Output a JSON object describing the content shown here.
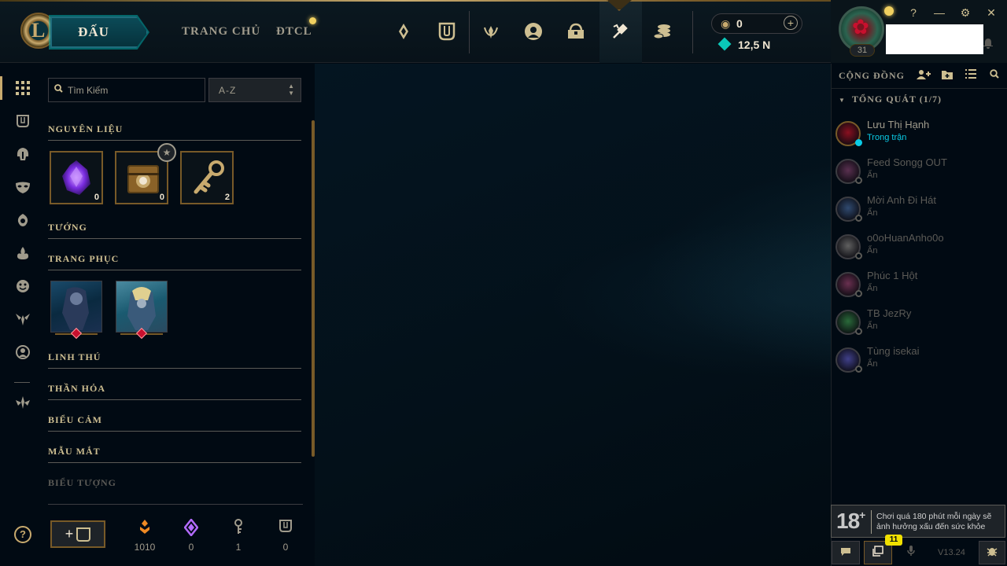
{
  "topbar": {
    "logo": "L",
    "play_label": "ĐẤU",
    "nav": [
      {
        "label": "TRANG CHỦ"
      },
      {
        "label": "ĐTCL"
      }
    ],
    "icons": [
      "ranked-icon",
      "collection-icon",
      "clash-icon",
      "profile-icon",
      "loot-icon",
      "crafting-icon",
      "store-icon"
    ],
    "rp_value": "0",
    "be_value": "12,5 N",
    "level": "31",
    "win_buttons": [
      "?",
      "—",
      "⚙",
      "✕"
    ]
  },
  "inventory": {
    "search_placeholder": "Tìm Kiếm",
    "sort_label": "A-Z",
    "categories": [
      "NGUYÊN LIỆU",
      "TƯỚNG",
      "TRANG PHỤC",
      "LINH THÚ",
      "THẦN HỎA",
      "BIỂU CẢM",
      "MẪU MẮT",
      "BIỂU TƯỢNG"
    ],
    "materials": [
      {
        "name": "essence-crystal",
        "count": "0"
      },
      {
        "name": "hextech-chest",
        "count": "0"
      },
      {
        "name": "hextech-key",
        "count": "2"
      }
    ],
    "resources": [
      {
        "icon": "orange-essence-icon",
        "value": "1010",
        "color": "#f08a24"
      },
      {
        "icon": "mythic-essence-icon",
        "value": "0",
        "color": "#b36bff"
      },
      {
        "icon": "key-fragment-icon",
        "value": "1",
        "color": "#a09b8c"
      },
      {
        "icon": "chest-icon",
        "value": "0",
        "color": "#a09b8c"
      }
    ]
  },
  "social": {
    "title": "CỘNG ĐỒNG",
    "group": "TỔNG QUÁT (1/7)",
    "friends": [
      {
        "name": "Lưu Thị Hạnh",
        "status": "Trong trận",
        "online": true,
        "color": "#8a1020"
      },
      {
        "name": "Feed Songg OUT",
        "status": "Ẩn",
        "online": false,
        "color": "#5a3050"
      },
      {
        "name": "Mời Anh Đi Hát",
        "status": "Ẩn",
        "online": false,
        "color": "#304a70"
      },
      {
        "name": "o0oHuanAnho0o",
        "status": "Ẩn",
        "online": false,
        "color": "#606060"
      },
      {
        "name": "Phúc 1 Hột",
        "status": "Ẩn",
        "online": false,
        "color": "#6a3050"
      },
      {
        "name": "TB JezRy",
        "status": "Ẩn",
        "online": false,
        "color": "#2a6a3a"
      },
      {
        "name": "Tùng isekai",
        "status": "Ẩn",
        "online": false,
        "color": "#40408a"
      }
    ],
    "age_rating": "18",
    "age_plus": "+",
    "age_warning": "Chơi quá 180 phút mỗi ngày sẽ ảnh hưởng xấu đến sức khỏe",
    "notification_count": "11",
    "version": "V13.24"
  }
}
